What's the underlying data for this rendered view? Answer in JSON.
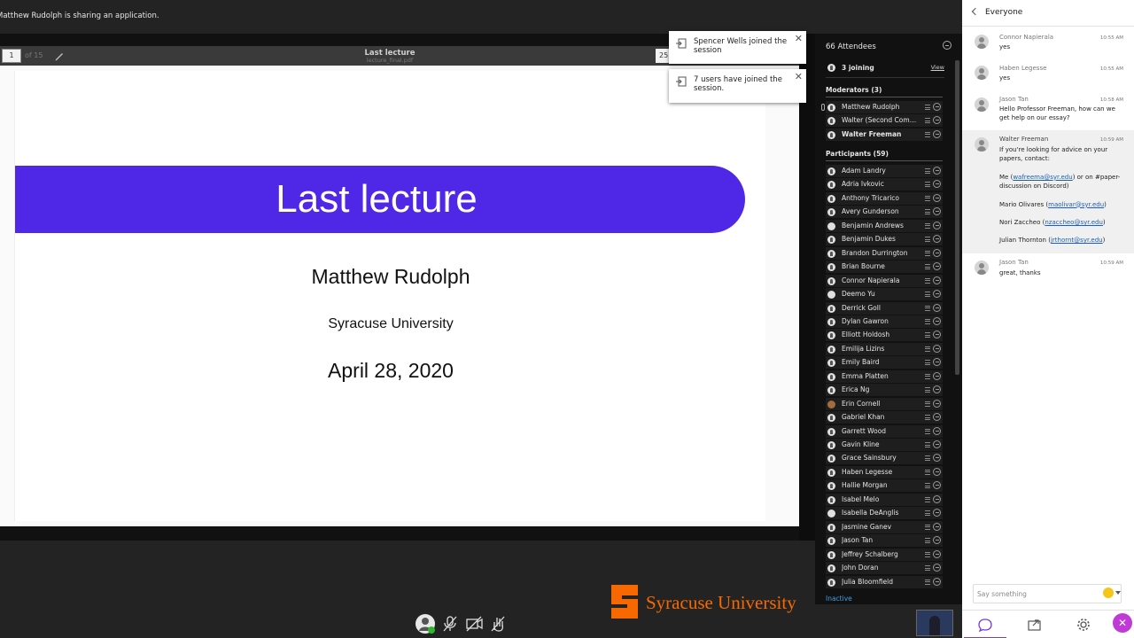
{
  "share_banner": "Matthew Rudolph is sharing an application.",
  "viewer": {
    "page_value": "1",
    "page_of": "of 15",
    "doc_title": "Last lecture",
    "doc_file": "lecture_final.pdf",
    "zoom_value": "25"
  },
  "slide": {
    "title": "Last lecture",
    "author": "Matthew Rudolph",
    "affiliation": "Syracuse University",
    "date": "April 28, 2020"
  },
  "toasts": [
    {
      "text": "Spencer Wells joined the session"
    },
    {
      "text": "7 users have joined the session."
    }
  ],
  "attendees": {
    "header": "66 Attendees",
    "joining": "3 joining",
    "view": "View",
    "moderators_header": "Moderators (3)",
    "moderators": [
      "Matthew Rudolph",
      "Walter (Second Comput…",
      "Walter Freeman"
    ],
    "participants_header": "Participants (59)",
    "participants": [
      "Adam Landry",
      "Adria Ivkovic",
      "Anthony Tricarico",
      "Avery Gunderson",
      "Benjamin Andrews",
      "Benjamin Dukes",
      "Brandon Durrington",
      "Brian Bourne",
      "Connor Napierala",
      "Deemo Yu",
      "Derrick Goll",
      "Dylan Gawron",
      "Elliott Holdosh",
      "Emilija Lizins",
      "Emily Baird",
      "Emma Platten",
      "Erica Ng",
      "Erin Cornell",
      "Gabriel Khan",
      "Garrett Wood",
      "Gavin Kline",
      "Grace Sainsbury",
      "Haben Legesse",
      "Hallie Morgan",
      "Isabel Melo",
      "Isabella DeAnglis",
      "Jasmine Ganev",
      "Jason Tan",
      "Jeffrey Schalberg",
      "John Doran",
      "Julia Bloomfield"
    ],
    "inactive": "Inactive"
  },
  "brand": {
    "name": "Syracuse University",
    "color": "#f76900"
  },
  "chat": {
    "title": "Everyone",
    "messages": [
      {
        "name": "Connor Napierala",
        "time": "10:55 AM",
        "lines": [
          "yes"
        ]
      },
      {
        "name": "Haben Legesse",
        "time": "10:55 AM",
        "lines": [
          "yes"
        ]
      },
      {
        "name": "Jason Tan",
        "time": "10:58 AM",
        "lines": [
          "Hello Professor Freeman, how can we get help on our essay?"
        ]
      },
      {
        "name": "Walter Freeman",
        "time": "10:59 AM",
        "intro": "If you're looking for advice on your papers, contact:",
        "contacts": [
          {
            "pre": "Me (",
            "email": "wafreema@syr.edu",
            "post": ") or on #paper-discussion on Discord)"
          },
          {
            "pre": "Mario Olivares (",
            "email": "maolivar@syr.edu",
            "post": ")"
          },
          {
            "pre": "Nori Zaccheo (",
            "email": "nzaccheo@syr.edu",
            "post": ")"
          },
          {
            "pre": "Julian Thornton (",
            "email": "jrthornt@syr.edu",
            "post": ")"
          }
        ]
      },
      {
        "name": "Jason Tan",
        "time": "10:59 AM",
        "lines": [
          "great, thanks"
        ]
      }
    ],
    "input_placeholder": "Say something"
  }
}
